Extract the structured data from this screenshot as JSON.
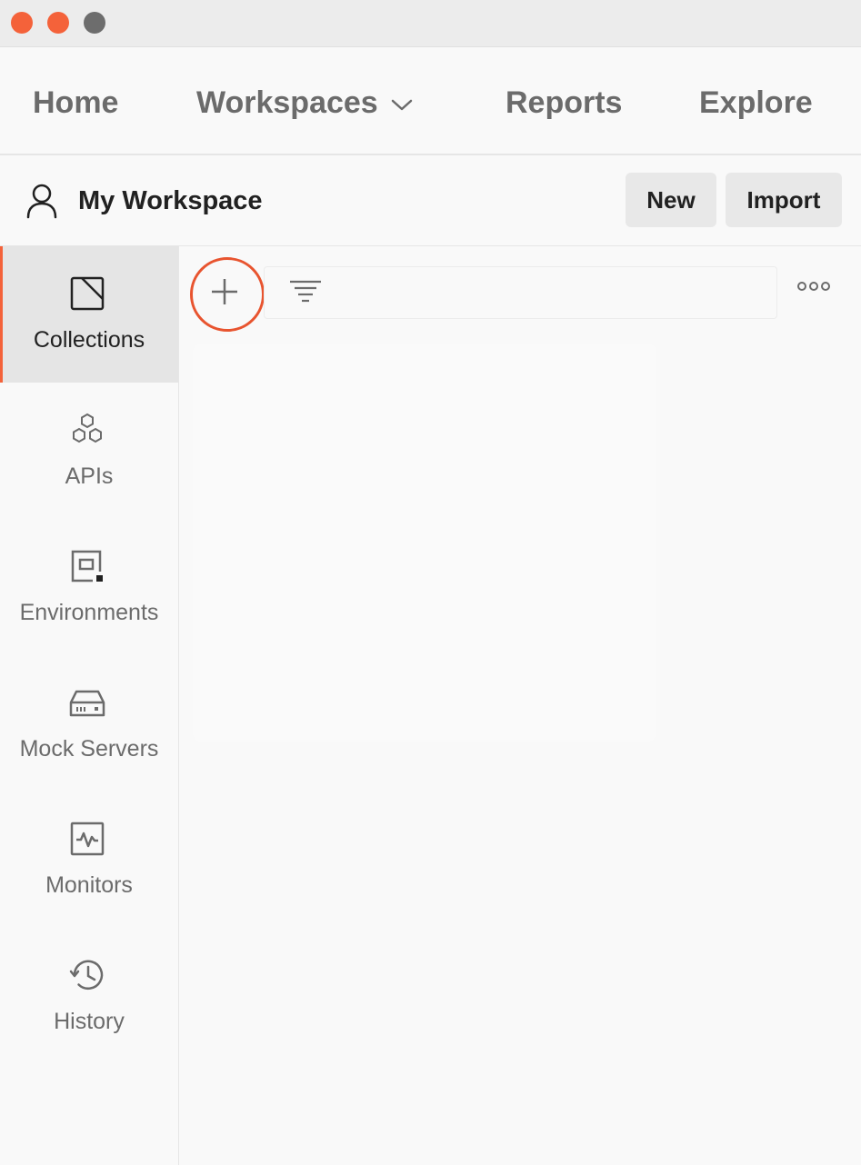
{
  "window": {
    "controls": [
      "close-dot",
      "minimize-dot",
      "maximize-dot"
    ]
  },
  "nav": {
    "home": "Home",
    "workspaces": "Workspaces",
    "reports": "Reports",
    "explore": "Explore"
  },
  "workspace": {
    "title": "My Workspace",
    "new_label": "New",
    "import_label": "Import"
  },
  "sidebar": {
    "items": [
      {
        "label": "Collections",
        "icon": "collections-icon",
        "active": true
      },
      {
        "label": "APIs",
        "icon": "apis-icon",
        "active": false
      },
      {
        "label": "Environments",
        "icon": "environments-icon",
        "active": false
      },
      {
        "label": "Mock Servers",
        "icon": "mock-servers-icon",
        "active": false
      },
      {
        "label": "Monitors",
        "icon": "monitors-icon",
        "active": false
      },
      {
        "label": "History",
        "icon": "history-icon",
        "active": false
      }
    ]
  },
  "toolbar": {
    "icons": [
      "plus-icon",
      "filter-icon",
      "more-icon"
    ]
  },
  "colors": {
    "accent": "#f4623a",
    "highlight_ring": "#e8542f",
    "muted_text": "#6b6b6b"
  }
}
